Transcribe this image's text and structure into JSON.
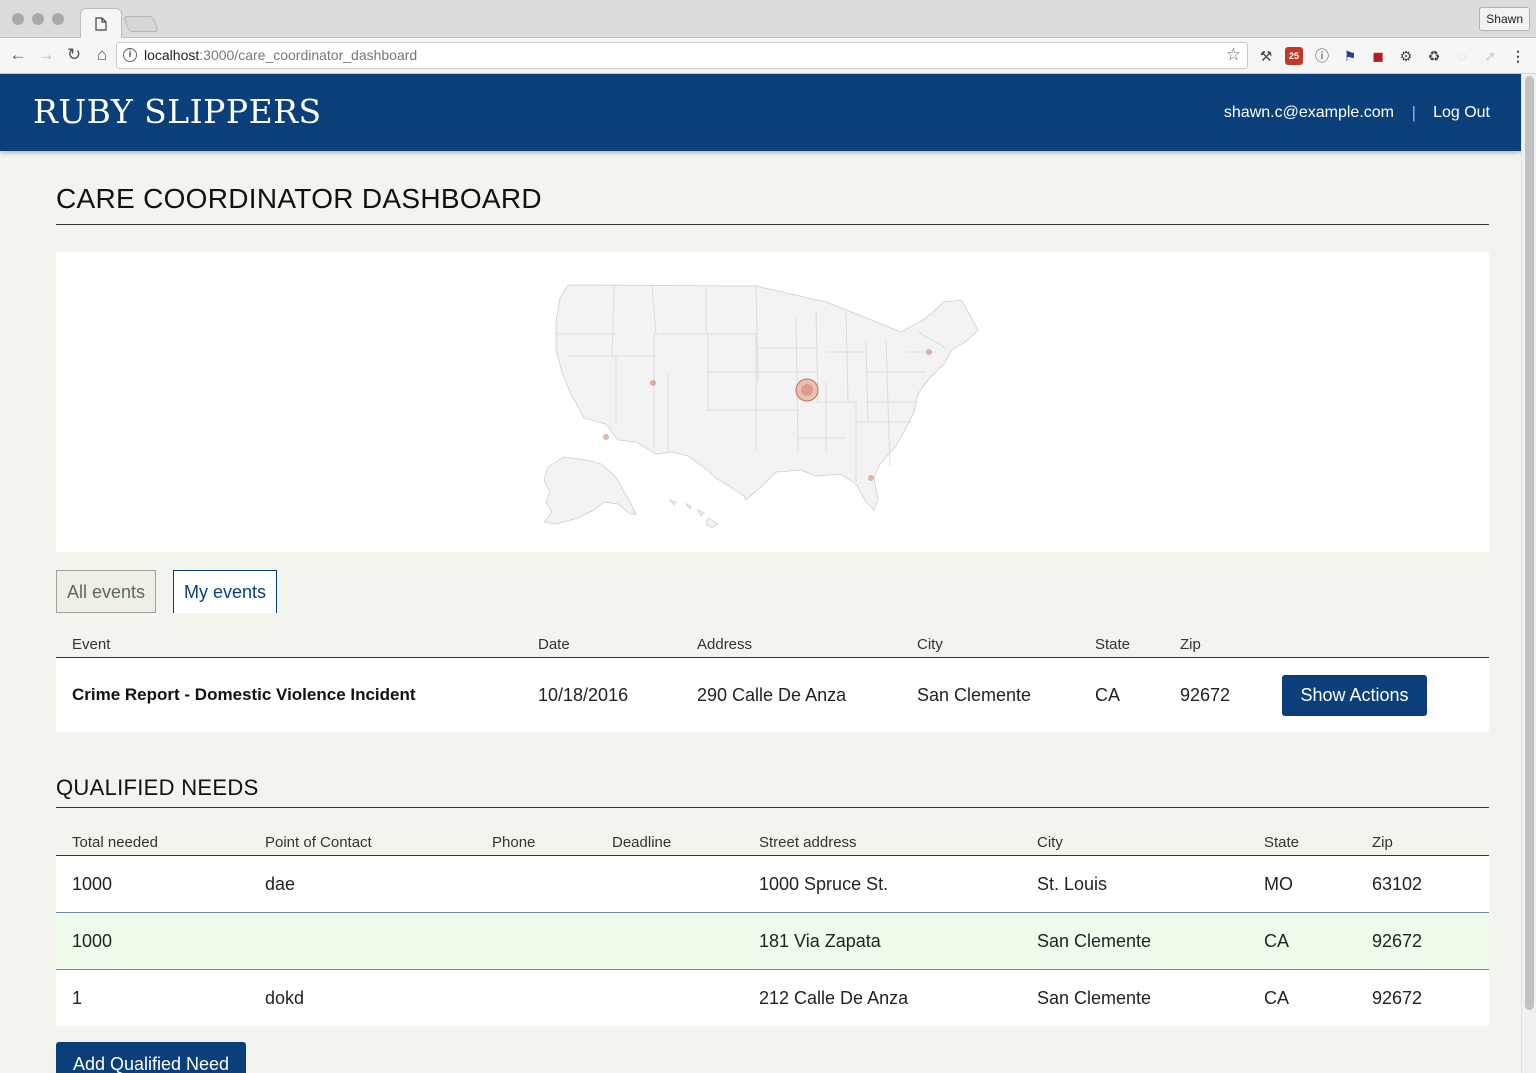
{
  "browser": {
    "profile": "Shawn",
    "url_host": "localhost",
    "url_path": ":3000/care_coordinator_dashboard",
    "extension_badge": "25"
  },
  "header": {
    "brand": "RUBY SLIPPERS",
    "user_email": "shawn.c@example.com",
    "separator": "|",
    "logout": "Log Out",
    "bg_color": "#0a3f7a"
  },
  "page": {
    "title": "CARE COORDINATOR DASHBOARD"
  },
  "map": {
    "region": "United States",
    "marker_color": "#d9826e"
  },
  "event_tabs": [
    {
      "label": "All events",
      "selected": false
    },
    {
      "label": "My events",
      "selected": true
    }
  ],
  "events_table": {
    "headers": [
      "Event",
      "Date",
      "Address",
      "City",
      "State",
      "Zip"
    ],
    "rows": [
      {
        "event": "Crime Report - Domestic Violence Incident",
        "date": "10/18/2016",
        "address": "290 Calle De Anza",
        "city": "San Clemente",
        "state": "CA",
        "zip": "92672",
        "action": "Show Actions"
      }
    ]
  },
  "qualified_needs": {
    "title": "QUALIFIED NEEDS",
    "headers": [
      "Total needed",
      "Point of Contact",
      "Phone",
      "Deadline",
      "Street address",
      "City",
      "State",
      "Zip"
    ],
    "rows": [
      {
        "total": "1000",
        "contact": "dae",
        "phone": "",
        "deadline": "",
        "street": "1000 Spruce St.",
        "city": "St. Louis",
        "state": "MO",
        "zip": "63102",
        "highlighted": false
      },
      {
        "total": "1000",
        "contact": "",
        "phone": "",
        "deadline": "",
        "street": "181 Via Zapata",
        "city": "San Clemente",
        "state": "CA",
        "zip": "92672",
        "highlighted": true
      },
      {
        "total": "1",
        "contact": "dokd",
        "phone": "",
        "deadline": "",
        "street": "212 Calle De Anza",
        "city": "San Clemente",
        "state": "CA",
        "zip": "92672",
        "highlighted": false
      }
    ],
    "add_button": "Add Qualified Need",
    "highlight_color": "#effcec"
  }
}
